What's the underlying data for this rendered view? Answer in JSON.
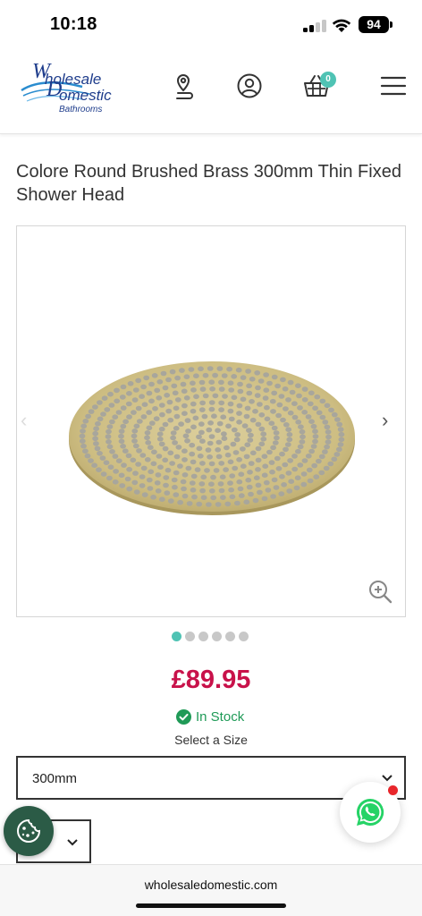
{
  "status_bar": {
    "time": "10:18",
    "battery": "94"
  },
  "header": {
    "logo": {
      "line1": "holesale",
      "letter_w": "W",
      "line2": "omestic",
      "letter_d": "D",
      "line3": "Bathrooms"
    },
    "icons": [
      "store-locator-icon",
      "account-icon",
      "basket-icon",
      "menu-icon"
    ],
    "basket_count": "0"
  },
  "product": {
    "title": "Colore Round Brushed Brass 300mm Thin Fixed Shower Head",
    "price": "£89.95",
    "stock": "In Stock",
    "size_label": "Select a Size",
    "size_selected": "300mm",
    "gallery_total": 6,
    "gallery_active": 1
  },
  "browser": {
    "url": "wholesaledomestic.com"
  },
  "colors": {
    "accent": "#4fc3b4",
    "price": "#c8124a",
    "stock": "#1f9a57",
    "brass": "#d4c48c"
  }
}
